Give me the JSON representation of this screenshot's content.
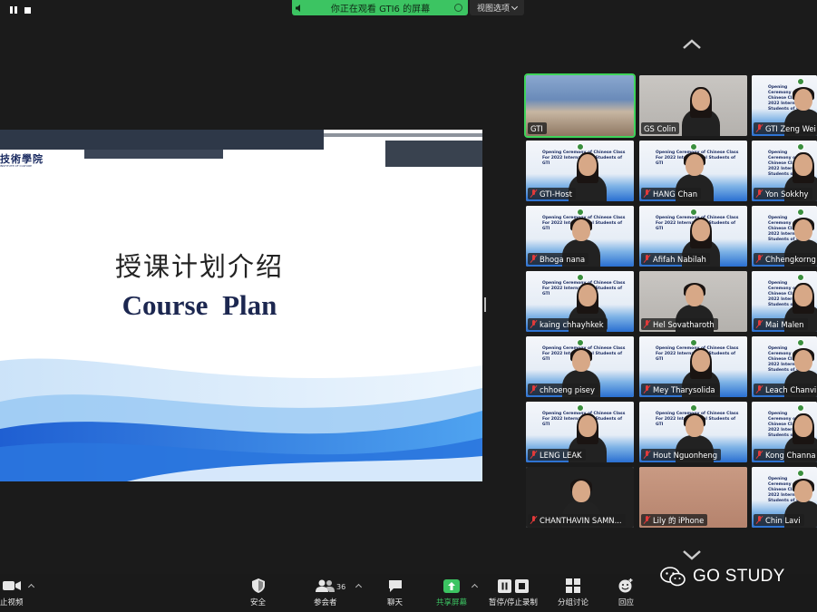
{
  "top_bar": {
    "banner_text": "你正在观看 GTI6 的屏幕",
    "view_options_label": "视图选项"
  },
  "shared_slide": {
    "logo_text": "技術學院",
    "logo_subtext": "INSTITUTE OF CULTURE",
    "title_cn": "授课计划介绍",
    "title_en": "Course  Plan"
  },
  "gallery": {
    "slide_caption": "Opening Ceremony of Chinese Class For 2022 International Students of GTI",
    "participants": [
      {
        "name": "GTI",
        "muted": false,
        "bg": "room",
        "active": true
      },
      {
        "name": "GS Colin",
        "muted": false,
        "bg": "office"
      },
      {
        "name": "GTI Zeng Wei",
        "muted": true,
        "bg": "slide"
      },
      {
        "name": "GTI-Host",
        "muted": true,
        "bg": "slide"
      },
      {
        "name": "HANG Chan",
        "muted": true,
        "bg": "slide"
      },
      {
        "name": "Yon Sokkhy",
        "muted": true,
        "bg": "slide"
      },
      {
        "name": "Bhoga nana",
        "muted": true,
        "bg": "slide"
      },
      {
        "name": "Afifah Nabilah",
        "muted": true,
        "bg": "slide"
      },
      {
        "name": "Chhengkorng",
        "muted": true,
        "bg": "slide"
      },
      {
        "name": "kaing chhayhkek",
        "muted": true,
        "bg": "slide"
      },
      {
        "name": "Hel Sovatharoth",
        "muted": true,
        "bg": "office"
      },
      {
        "name": "Mai Malen",
        "muted": true,
        "bg": "slide"
      },
      {
        "name": "chhoeng pisey",
        "muted": true,
        "bg": "slide"
      },
      {
        "name": "Mey Tharysolida",
        "muted": true,
        "bg": "slide"
      },
      {
        "name": "Leach Chanvi",
        "muted": true,
        "bg": "slide"
      },
      {
        "name": "LENG LEAK",
        "muted": true,
        "bg": "slide"
      },
      {
        "name": "Hout Nguonheng",
        "muted": true,
        "bg": "slide"
      },
      {
        "name": "Kong Channa",
        "muted": true,
        "bg": "slide"
      },
      {
        "name": "CHANTHAVIN SAMN...",
        "muted": true,
        "bg": "dark"
      },
      {
        "name": "Lily 的 iPhone",
        "muted": true,
        "bg": "skin"
      },
      {
        "name": "Chin Lavi",
        "muted": true,
        "bg": "slide"
      }
    ]
  },
  "toolbar": {
    "stop_video": "止视频",
    "security": "安全",
    "participants": "参会者",
    "participant_count": "36",
    "chat": "聊天",
    "share_screen": "共享屏幕",
    "pause_stop_recording": "暂停/停止录制",
    "breakout_rooms": "分组讨论",
    "reactions": "回应"
  },
  "watermark": {
    "text": "GO STUDY"
  },
  "colors": {
    "share_green": "#3cc462",
    "active_speaker": "#3fd45b",
    "muted_red": "#e23a3a",
    "background": "#1b1b1b"
  }
}
